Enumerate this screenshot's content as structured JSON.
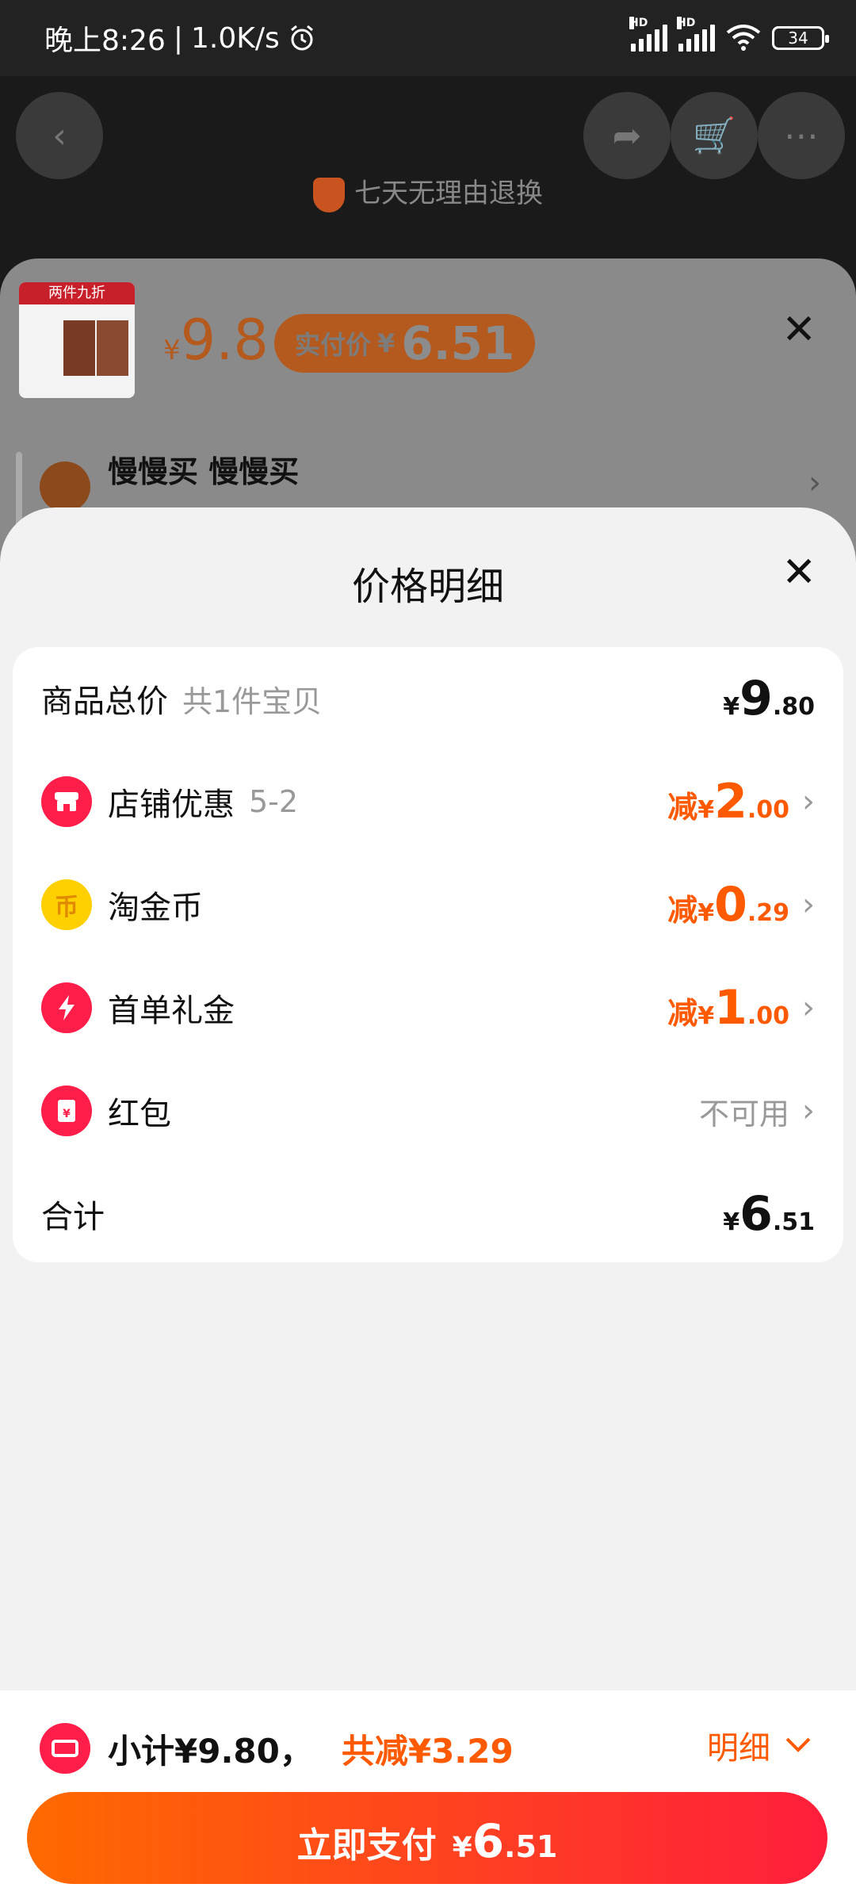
{
  "status_bar": {
    "time": "晚上8:26",
    "speed": "1.0K/s",
    "alarm_icon": "alarm-icon",
    "battery": "34",
    "signal_label": "HD"
  },
  "background": {
    "tag": "七天无理由退换"
  },
  "sku_sheet": {
    "thumb_band": "两件九折",
    "price_yen": "¥",
    "price": "9.8",
    "actual_label": "实付价",
    "actual_yen": "¥",
    "actual_price": "6.51",
    "address_name": "慢慢买 慢慢买"
  },
  "price_detail": {
    "title": "价格明细",
    "rows": [
      {
        "label": "商品总价",
        "sub": "共1件宝贝",
        "prefix": "",
        "yen": "¥",
        "int": "9",
        "dec": ".80"
      },
      {
        "label": "店铺优惠",
        "sub": "5-2",
        "prefix": "减",
        "yen": "¥",
        "int": "2",
        "dec": ".00",
        "icon": "store-icon",
        "icon_color": "#ff1e4a"
      },
      {
        "label": "淘金币",
        "sub": "",
        "prefix": "减",
        "yen": "¥",
        "int": "0",
        "dec": ".29",
        "icon": "coin-icon",
        "icon_color": "#ffd000"
      },
      {
        "label": "首单礼金",
        "sub": "",
        "prefix": "减",
        "yen": "¥",
        "int": "1",
        "dec": ".00",
        "icon": "lightning-icon",
        "icon_color": "#ff1e4a"
      },
      {
        "label": "红包",
        "sub": "",
        "status": "不可用",
        "icon": "red-packet-icon",
        "icon_color": "#ff1e4a"
      },
      {
        "label": "合计",
        "yen": "¥",
        "int": "6",
        "dec": ".51"
      }
    ]
  },
  "bottom_bar": {
    "subtotal": "小计¥9.80，",
    "discount": "共减¥3.29",
    "detail_label": "明细",
    "pay_label": "立即支付",
    "pay_yen": "¥",
    "pay_int": "6",
    "pay_dec": ".51"
  },
  "colors": {
    "accent": "#ff5a00",
    "pay_gradient_start": "#ff6a00",
    "pay_gradient_end": "#ff1e3c"
  }
}
